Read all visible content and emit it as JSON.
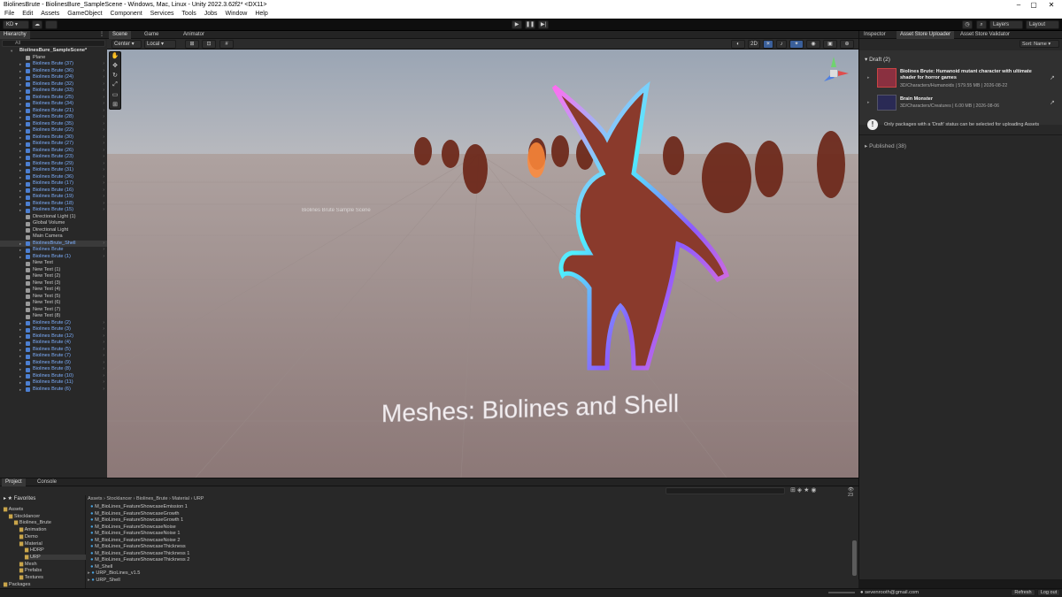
{
  "window": {
    "title": "BiolinesBrute - BiolinesBure_SampleScene - Windows, Mac, Linux - Unity 2022.3.62f2* <DX11>"
  },
  "menu": [
    "File",
    "Edit",
    "Assets",
    "GameObject",
    "Component",
    "Services",
    "Tools",
    "Jobs",
    "Window",
    "Help"
  ],
  "toolbar": {
    "account": "KD",
    "layers": "Layers",
    "layout": "Layout"
  },
  "hierarchy": {
    "tab": "Hierarchy",
    "search_placeholder": "All",
    "scene": "BiolinesBure_SampleScene*",
    "items": [
      {
        "label": "Plane",
        "blue": false
      },
      {
        "label": "Biolines Brute (37)",
        "blue": true
      },
      {
        "label": "Biolines Brute (36)",
        "blue": true
      },
      {
        "label": "Biolines Brute (24)",
        "blue": true
      },
      {
        "label": "Biolines Brute (32)",
        "blue": true
      },
      {
        "label": "Biolines Brute (33)",
        "blue": true
      },
      {
        "label": "Biolines Brute (25)",
        "blue": true
      },
      {
        "label": "Biolines Brute (34)",
        "blue": true
      },
      {
        "label": "Biolines Brute (21)",
        "blue": true
      },
      {
        "label": "Biolines Brute (28)",
        "blue": true
      },
      {
        "label": "Biolines Brute (35)",
        "blue": true
      },
      {
        "label": "Biolines Brute (22)",
        "blue": true
      },
      {
        "label": "Biolines Brute (30)",
        "blue": true
      },
      {
        "label": "Biolines Brute (27)",
        "blue": true
      },
      {
        "label": "Biolines Brute (26)",
        "blue": true
      },
      {
        "label": "Biolines Brute (23)",
        "blue": true
      },
      {
        "label": "Biolines Brute (29)",
        "blue": true
      },
      {
        "label": "Biolines Brute (31)",
        "blue": true
      },
      {
        "label": "Biolines Brute (36)",
        "blue": true
      },
      {
        "label": "Biolines Brute (17)",
        "blue": true
      },
      {
        "label": "Biolines Brute (16)",
        "blue": true
      },
      {
        "label": "Biolines Brute (19)",
        "blue": true
      },
      {
        "label": "Biolines Brute (18)",
        "blue": true
      },
      {
        "label": "Biolines Brute (15)",
        "blue": true
      },
      {
        "label": "Directional Light (1)",
        "blue": false
      },
      {
        "label": "Global Volume",
        "blue": false
      },
      {
        "label": "Directional Light",
        "blue": false
      },
      {
        "label": "Main Camera",
        "blue": false
      },
      {
        "label": "BiolinesBrute_Shell",
        "blue": true
      },
      {
        "label": "Biolines Brute",
        "blue": true
      },
      {
        "label": "Biolines Brute (1)",
        "blue": true
      },
      {
        "label": "New Text",
        "blue": false
      },
      {
        "label": "New Text (1)",
        "blue": false
      },
      {
        "label": "New Text (2)",
        "blue": false
      },
      {
        "label": "New Text (3)",
        "blue": false
      },
      {
        "label": "New Text (4)",
        "blue": false
      },
      {
        "label": "New Text (5)",
        "blue": false
      },
      {
        "label": "New Text (6)",
        "blue": false
      },
      {
        "label": "New Text (7)",
        "blue": false
      },
      {
        "label": "New Text (8)",
        "blue": false
      },
      {
        "label": "Biolines Brute (2)",
        "blue": true
      },
      {
        "label": "Biolines Brute (3)",
        "blue": true
      },
      {
        "label": "Biolines Brute (12)",
        "blue": true
      },
      {
        "label": "Biolines Brute (4)",
        "blue": true
      },
      {
        "label": "Biolines Brute (5)",
        "blue": true
      },
      {
        "label": "Biolines Brute (7)",
        "blue": true
      },
      {
        "label": "Biolines Brute (9)",
        "blue": true
      },
      {
        "label": "Biolines Brute (8)",
        "blue": true
      },
      {
        "label": "Biolines Brute (10)",
        "blue": true
      },
      {
        "label": "Biolines Brute (11)",
        "blue": true
      },
      {
        "label": "Biolines Brute (6)",
        "blue": true
      }
    ]
  },
  "scene_view": {
    "tabs": [
      "Scene",
      "Game",
      "Animator"
    ],
    "pivot": "Center",
    "space": "Local",
    "mode_2d": "2D",
    "overlay_text": "Meshes: Biolines and Shell",
    "back_text": "Biolines Brute Sample Scene"
  },
  "inspector": {
    "tabs": [
      "Inspector",
      "Asset Store Uploader",
      "Asset Store Validator"
    ],
    "sort": "Sort: Name",
    "draft_header": "Draft (2)",
    "packages": [
      {
        "title": "Biolines Brute: Humanoid mutant character with ultimate shader for horror games",
        "meta": "3D/Characters/Humanoids | 579.55 MB | 2026-08-22"
      },
      {
        "title": "Brain Monster",
        "meta": "3D/Characters/Creatures | 6.00 MB | 2026-08-06"
      }
    ],
    "notice": "Only packages with a 'Draft' status can be selected for uploading Assets",
    "published_header": "Published (38)",
    "email": "sevenrooth@gmail.com",
    "refresh": "Refresh",
    "logout": "Log out"
  },
  "project": {
    "tabs": [
      "Project",
      "Console"
    ],
    "favorites": "Favorites",
    "tree": [
      {
        "label": "Assets",
        "indent": 0
      },
      {
        "label": "Stocklancer",
        "indent": 1
      },
      {
        "label": "Biolines_Brute",
        "indent": 2
      },
      {
        "label": "Animation",
        "indent": 3
      },
      {
        "label": "Demo",
        "indent": 3
      },
      {
        "label": "Material",
        "indent": 3
      },
      {
        "label": "HDRP",
        "indent": 4
      },
      {
        "label": "URP",
        "indent": 4
      },
      {
        "label": "Mesh",
        "indent": 3
      },
      {
        "label": "Prefabs",
        "indent": 3
      },
      {
        "label": "Textures",
        "indent": 3
      },
      {
        "label": "Packages",
        "indent": 0
      }
    ],
    "breadcrumb": [
      "Assets",
      "Stocklancer",
      "Biolines_Brute",
      "Material",
      "URP"
    ],
    "files": [
      "M_BioLines_FeatureShowcaseEmission 1",
      "M_BioLines_FeatureShowcaseGrowth",
      "M_BioLines_FeatureShowcaseGrowth 1",
      "M_BioLines_FeatureShowcaseNoise",
      "M_BioLines_FeatureShowcaseNoise 1",
      "M_BioLines_FeatureShowcaseNoise 2",
      "M_BioLines_FeatureShowcaseThickness",
      "M_BioLines_FeatureShowcaseThickness 1",
      "M_BioLines_FeatureShowcaseThickness 2",
      "M_Shell",
      "URP_BioLines_v1.5",
      "URP_Shell"
    ],
    "count": "23"
  }
}
